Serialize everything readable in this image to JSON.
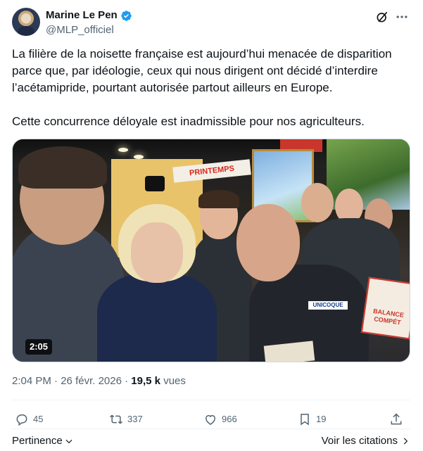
{
  "author": {
    "display_name": "Marine Le Pen",
    "handle": "@MLP_officiel",
    "verified": true
  },
  "icons": {
    "verified": "verified-badge-icon",
    "grok": "grok-icon",
    "more": "more-dots-icon",
    "reply": "reply-icon",
    "retweet": "retweet-icon",
    "like": "heart-icon",
    "bookmark": "bookmark-icon",
    "share": "share-icon"
  },
  "colors": {
    "verified_blue": "#1d9bf0",
    "text_primary": "#0f1419",
    "text_secondary": "#536471"
  },
  "tweet": {
    "paragraphs": [
      "La filière de la noisette française est aujourd’hui menacée de disparition parce que, par idéologie, ceux qui nous dirigent ont décidé d’interdire l’acétamipride, pourtant autorisée partout ailleurs en Europe.",
      "Cette concurrence déloyale est inadmissible pour nos agriculteurs."
    ]
  },
  "media": {
    "duration": "2:05",
    "sign_printemps": "PRINTEMPS",
    "vest_logo": "UNICOQUE",
    "sign_balance": "BALANCE COMPÉT"
  },
  "meta": {
    "time": "2:04 PM",
    "separator": "·",
    "date": "26 févr. 2026",
    "views_count": "19,5 k",
    "views_label": "vues"
  },
  "actions": {
    "replies": "45",
    "retweets": "337",
    "likes": "966",
    "bookmarks": "19"
  },
  "footer": {
    "sort_label": "Pertinence",
    "quotes_label": "Voir les citations"
  }
}
